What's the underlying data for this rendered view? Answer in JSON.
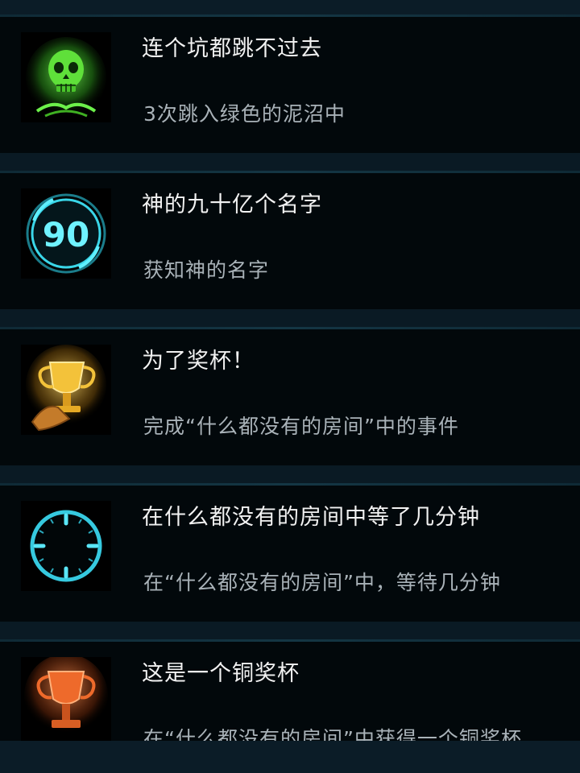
{
  "achievements": [
    {
      "title": "连个坑都跳不过去",
      "description": "3次跳入绿色的泥沼中",
      "icon": "green-skull-icon",
      "color": "#57d13a"
    },
    {
      "title": "神的九十亿个名字",
      "description": "获知神的名字",
      "icon": "ninety-dial-icon",
      "icon_text": "90",
      "color": "#3ad6e8"
    },
    {
      "title": "为了奖杯！",
      "description": "完成“什么都没有的房间”中的事件",
      "icon": "gold-trophy-icon",
      "color": "#f0b62a"
    },
    {
      "title": "在什么都没有的房间中等了几分钟",
      "description": "在“什么都没有的房间”中，等待几分钟",
      "icon": "clock-icon",
      "color": "#36c9df"
    },
    {
      "title": "这是一个铜奖杯",
      "description": "在“什么都没有的房间”中获得一个铜奖杯",
      "icon": "bronze-trophy-icon",
      "color": "#ee6a2b"
    }
  ]
}
